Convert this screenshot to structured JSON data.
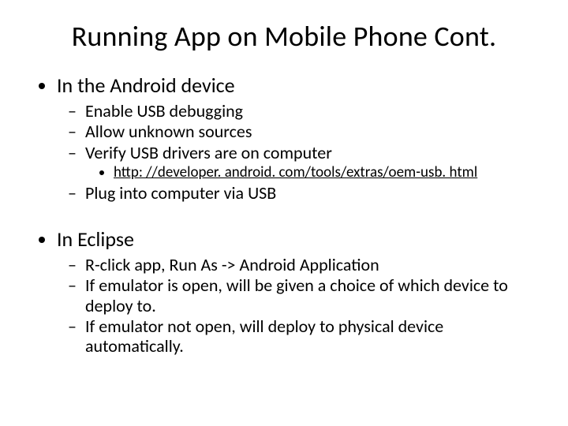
{
  "title": "Running App on Mobile Phone Cont.",
  "section1": {
    "heading": "In the Android device",
    "items": [
      "Enable USB debugging",
      "Allow unknown sources",
      "Verify USB drivers are on computer",
      "Plug into computer via USB"
    ],
    "link": "http: //developer. android. com/tools/extras/oem-usb. html"
  },
  "section2": {
    "heading": "In Eclipse",
    "items": [
      "R-click app, Run As -> Android Application",
      "If emulator is open, will be given a choice of which device to deploy to.",
      "If emulator not open, will deploy to physical device automatically."
    ]
  }
}
